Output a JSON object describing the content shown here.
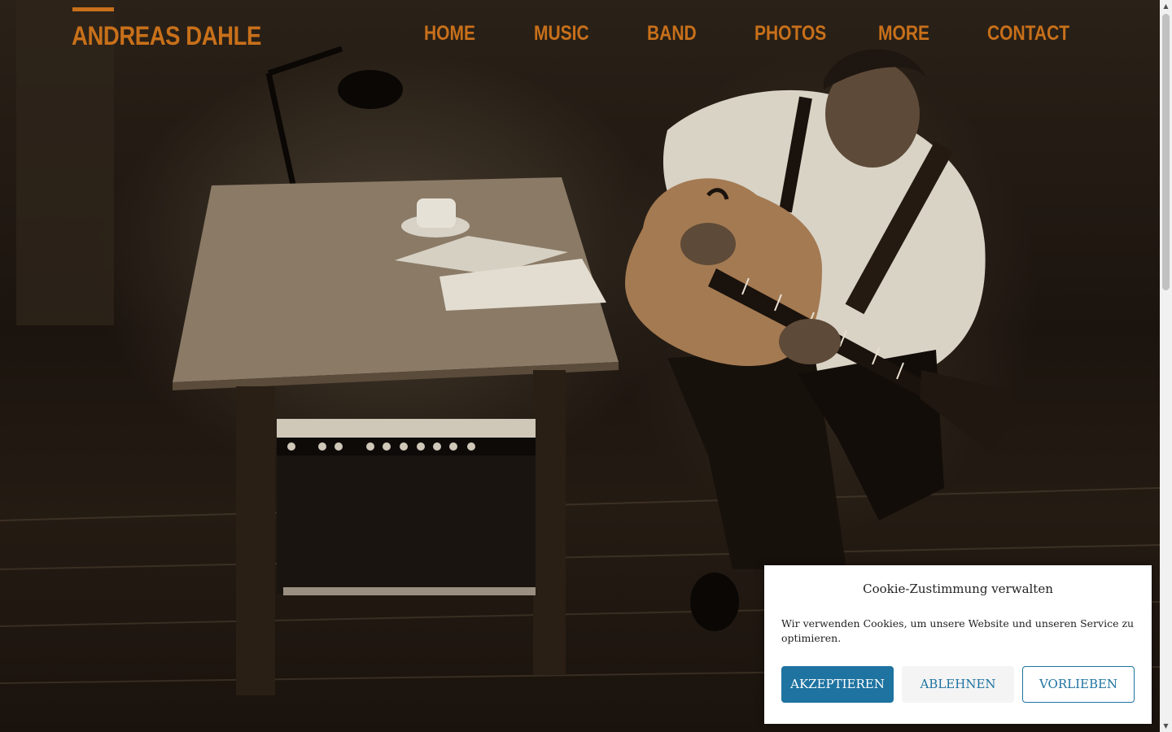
{
  "site": {
    "logo": "ANDREAS DAHLE"
  },
  "nav": {
    "items": [
      {
        "label": "HOME"
      },
      {
        "label": "MUSIC"
      },
      {
        "label": "BAND"
      },
      {
        "label": "PHOTOS"
      },
      {
        "label": "MORE"
      },
      {
        "label": "CONTACT"
      }
    ]
  },
  "hero": {
    "image": "sepia photo of guitarist playing archtop guitar beside table with amplifier"
  },
  "cookie": {
    "title": "Cookie-Zustimmung verwalten",
    "text": "Wir verwenden Cookies, um unsere Website und unseren Service zu optimieren.",
    "accept_label": "AKZEPTIEREN",
    "deny_label": "ABLEHNEN",
    "preferences_label": "VORLIEBEN"
  },
  "colors": {
    "accent": "#c8701a",
    "button_blue": "#1e73a0"
  }
}
